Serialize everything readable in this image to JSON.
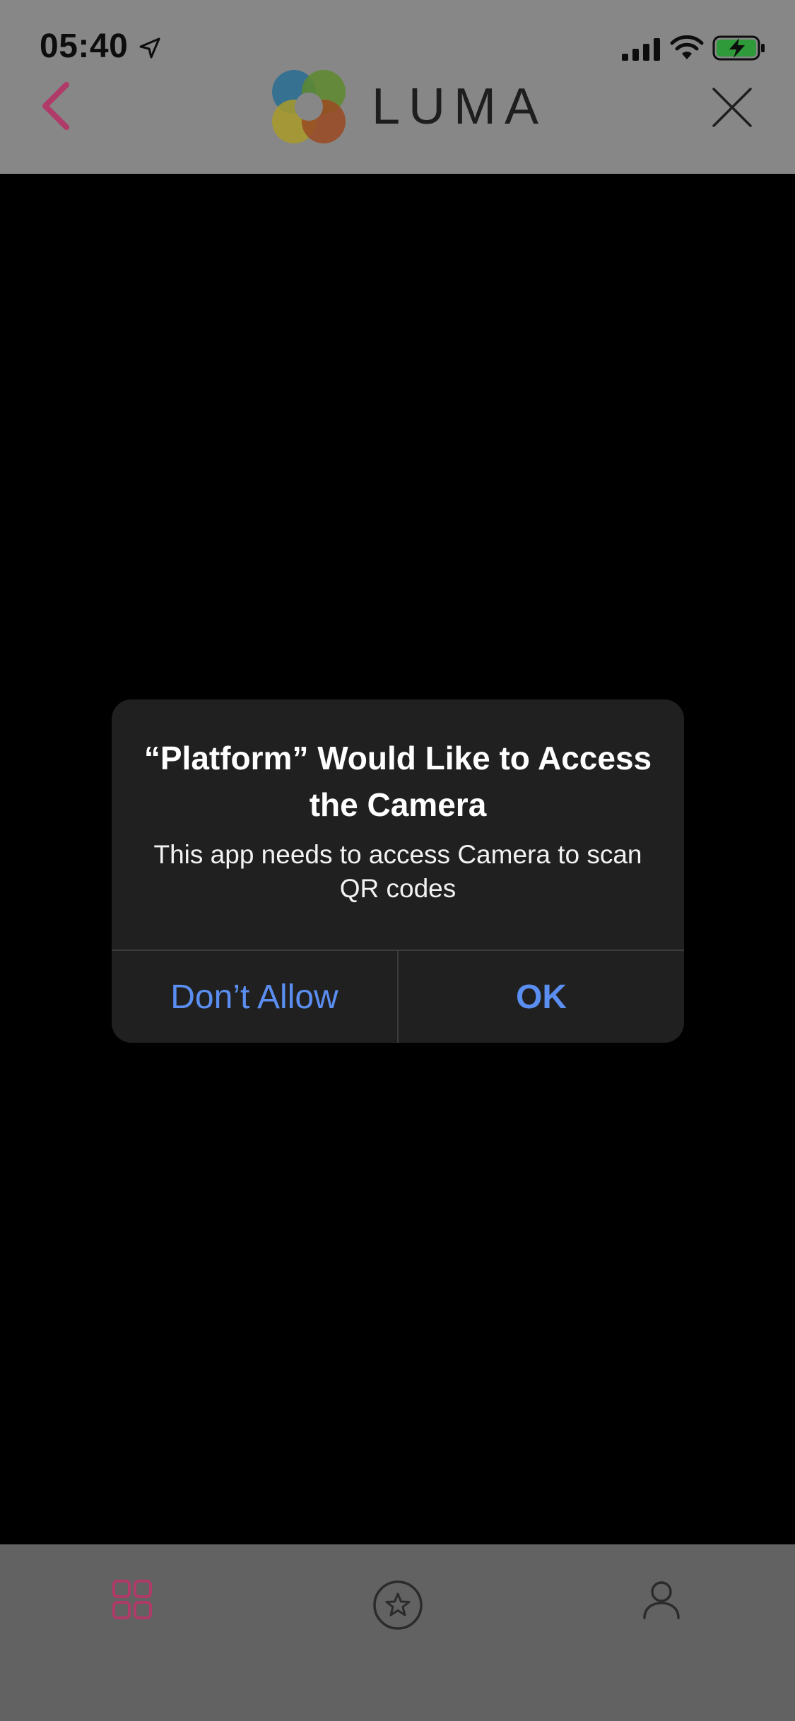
{
  "status_bar": {
    "time": "05:40",
    "icons": [
      "location-arrow-icon",
      "cellular-signal-icon",
      "wifi-icon",
      "battery-charging-icon"
    ]
  },
  "nav": {
    "back_icon": "chevron-left-icon",
    "logo_text": "LUMA",
    "close_icon": "close-icon"
  },
  "dialog": {
    "title": "“Platform” Would Like to Access the Camera",
    "message": "This app needs to access Camera to scan QR codes",
    "deny_label": "Don’t Allow",
    "ok_label": "OK"
  },
  "tabbar": {
    "tabs": [
      {
        "icon": "grid-icon",
        "active": true
      },
      {
        "icon": "star-circle-icon",
        "active": false
      },
      {
        "icon": "profile-icon",
        "active": false
      }
    ]
  },
  "colors": {
    "accent": "#b03a68",
    "dialog_button": "#5b8ef1",
    "battery_green": "#2f9a3a"
  }
}
